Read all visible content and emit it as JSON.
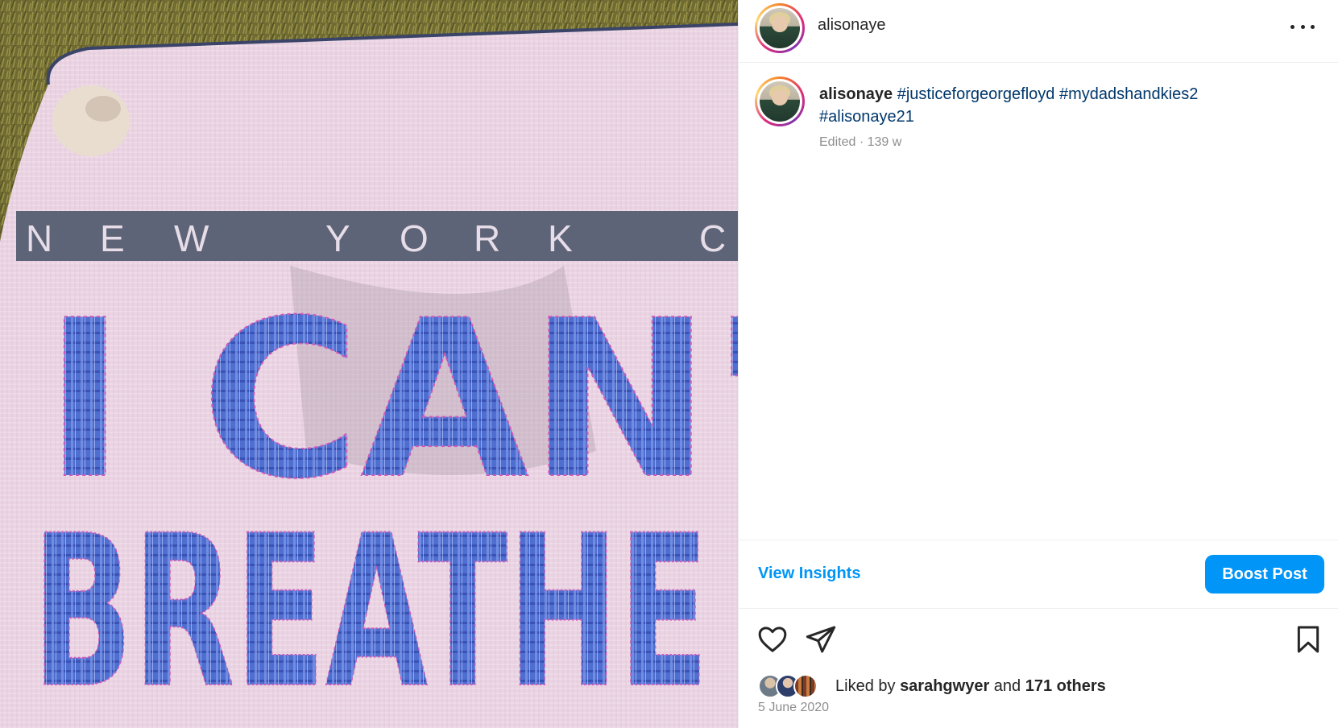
{
  "post": {
    "username": "alisonaye",
    "photo": {
      "alt_band_text": "N E W   Y O R K   C",
      "headline_line1": "I CAN'T",
      "headline_line2": "BREATHE"
    },
    "caption": {
      "username": "alisonaye",
      "hashtags": [
        "#justiceforgeorgefloyd",
        "#mydadshandkies2",
        "#alisonaye21"
      ],
      "meta": "Edited · 139 w"
    },
    "insights_label": "View Insights",
    "boost_label": "Boost Post",
    "likes": {
      "prefix": "Liked by",
      "user": "sarahgwyer",
      "joiner": "and",
      "others": "171 others"
    },
    "date": "5 June 2020"
  },
  "icons": {
    "more": "more-horizontal-icon",
    "like": "heart-icon",
    "share": "paper-plane-icon",
    "save": "bookmark-icon"
  },
  "colors": {
    "link_blue": "#0095f6",
    "hashtag_blue": "#00376b",
    "muted": "#8e8e8e",
    "fabric_pink": "#ecd5e3",
    "patch_blue": "#4a66c9"
  }
}
